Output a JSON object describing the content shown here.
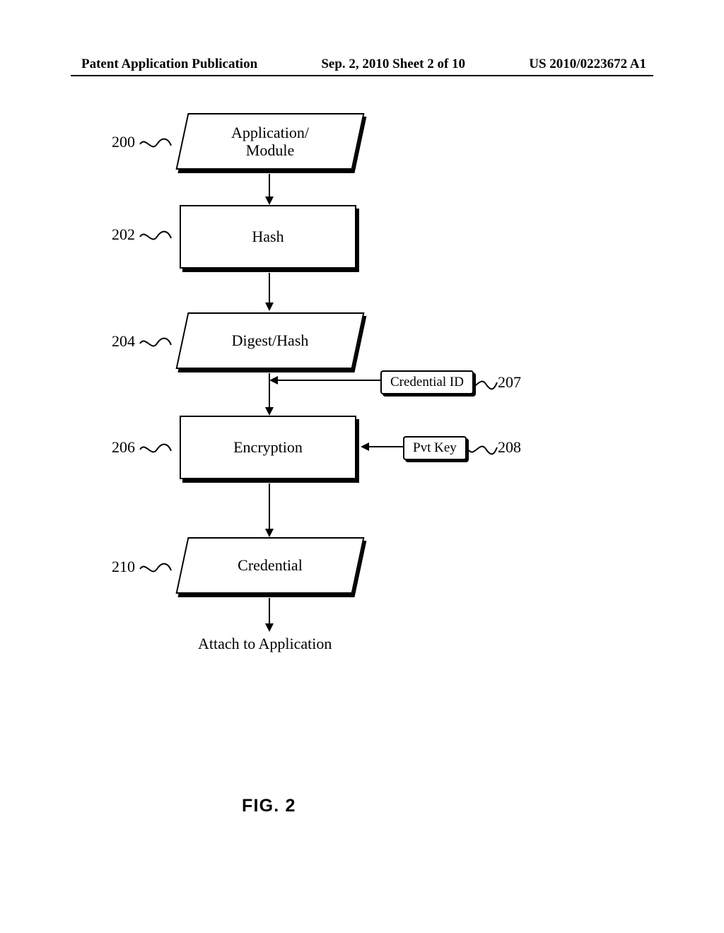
{
  "header": {
    "left": "Patent Application Publication",
    "mid": "Sep. 2, 2010  Sheet 2 of 10",
    "right": "US 2010/0223672 A1"
  },
  "nodes": {
    "app_module": "Application/\nModule",
    "hash": "Hash",
    "digest": "Digest/Hash",
    "encryption": "Encryption",
    "credential": "Credential",
    "cred_id": "Credential ID",
    "pvt_key": "Pvt Key"
  },
  "refs": {
    "r200": "200",
    "r202": "202",
    "r204": "204",
    "r206": "206",
    "r207": "207",
    "r208": "208",
    "r210": "210"
  },
  "captions": {
    "attach": "Attach to Application",
    "figure": "FIG. 2"
  }
}
